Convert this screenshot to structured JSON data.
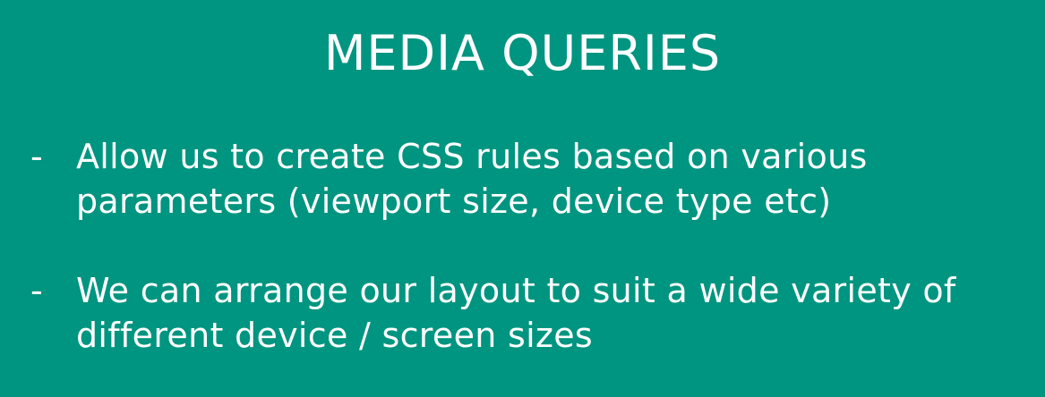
{
  "slide": {
    "title": "MEDIA QUERIES",
    "background_color": "#009580",
    "text_color": "#ffffff",
    "bullets": [
      {
        "marker": "-",
        "lines": [
          "Allow us to create CSS rules based on various",
          "parameters (viewport size, device type etc)"
        ]
      },
      {
        "marker": "-",
        "lines": [
          "We can arrange our layout to suit a wide variety of",
          "different device / screen sizes"
        ]
      }
    ]
  }
}
